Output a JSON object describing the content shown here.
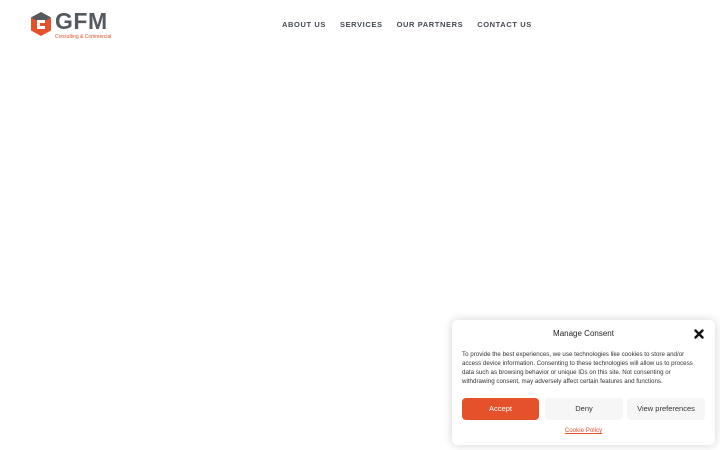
{
  "brand": {
    "name": "GFM",
    "tagline": "Consulting & Commercial",
    "accent_color": "#e4512a",
    "text_color": "#555a60"
  },
  "nav": {
    "items": [
      {
        "label": "ABOUT US"
      },
      {
        "label": "SERVICES"
      },
      {
        "label": "OUR PARTNERS"
      },
      {
        "label": "CONTACT US"
      }
    ]
  },
  "consent": {
    "title": "Manage Consent",
    "close_icon": "close-icon",
    "body": "To provide the best experiences, we use technologies like cookies to store and/or access device information. Consenting to these technologies will allow us to process data such as browsing behavior or unique IDs on this site. Not consenting or withdrawing consent, may adversely affect certain features and functions.",
    "accept_label": "Accept",
    "deny_label": "Deny",
    "preferences_label": "View preferences",
    "policy_link": "Cookie Policy"
  }
}
